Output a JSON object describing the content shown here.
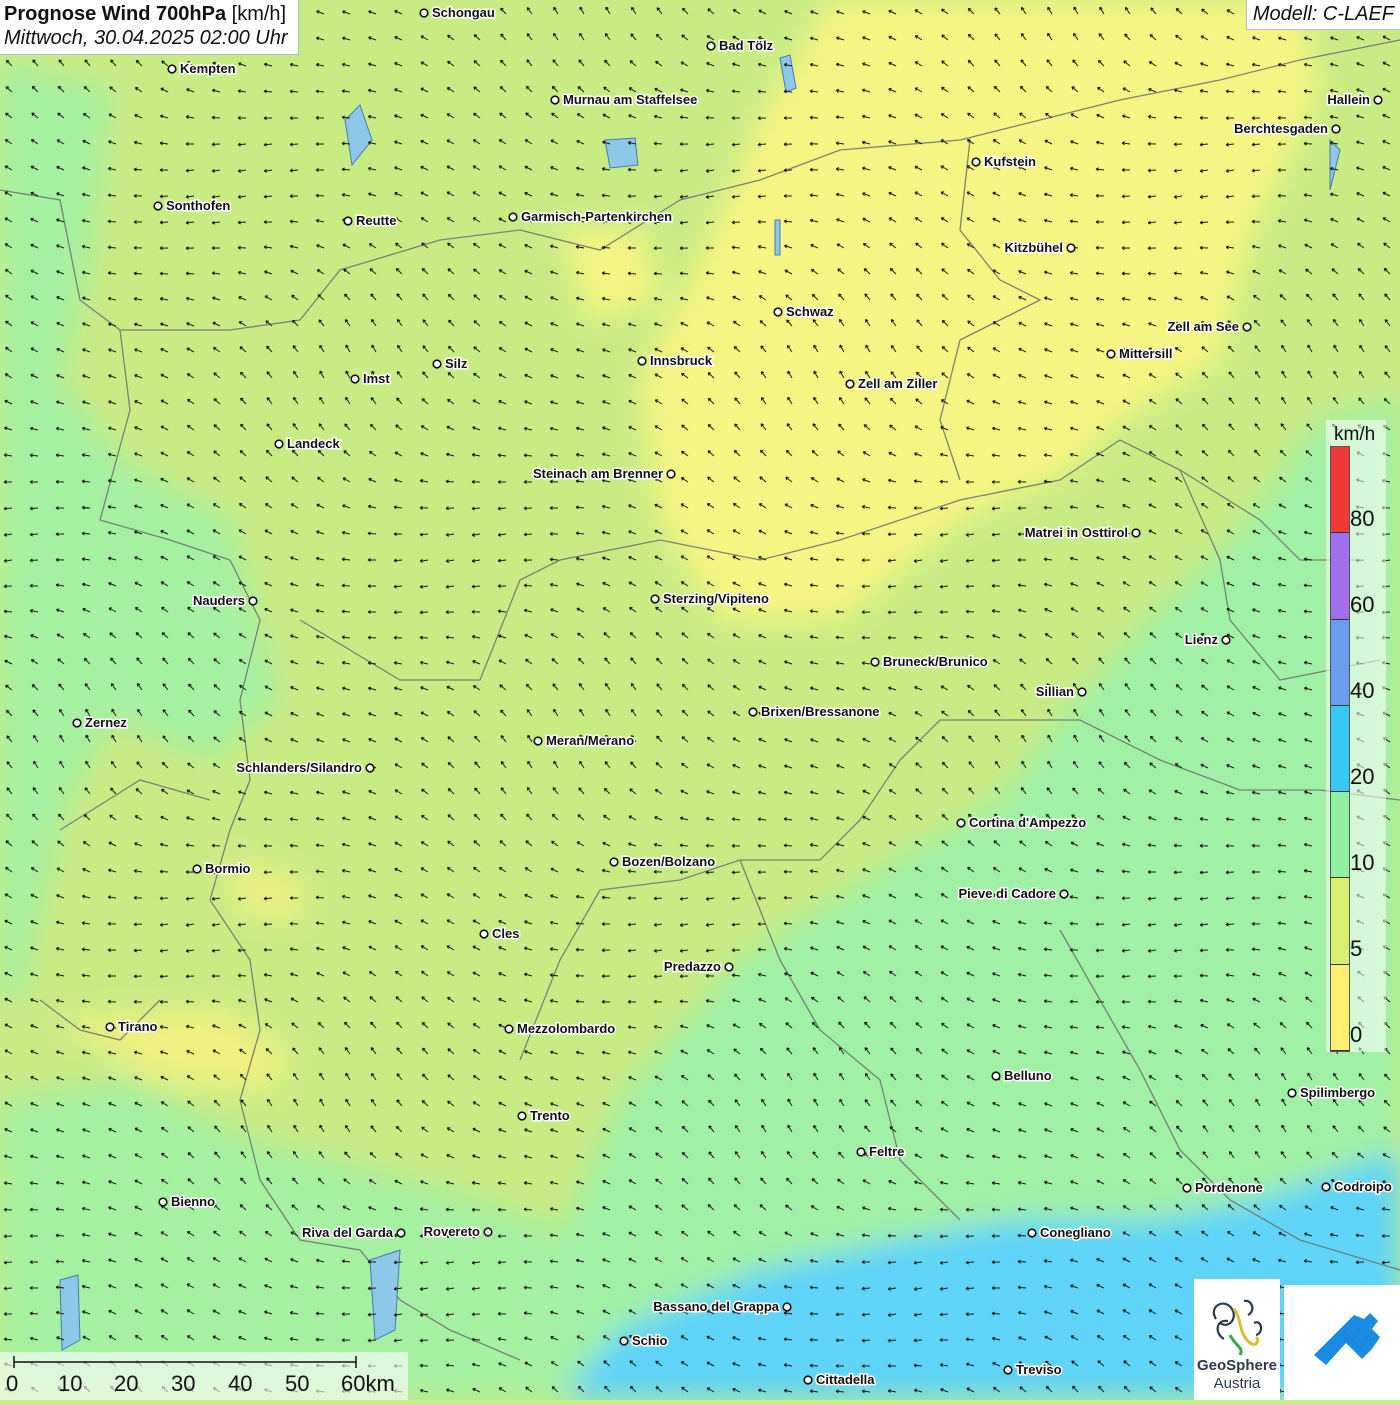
{
  "header": {
    "title_main": "Prognose Wind 700hPa",
    "title_unit": "[km/h]",
    "subtitle": "Mittwoch, 30.04.2025 02:00 Uhr",
    "model": "Modell: C-LAEF"
  },
  "legend": {
    "unit": "km/h",
    "ticks": [
      "80",
      "60",
      "40",
      "20",
      "10",
      "5",
      "0"
    ],
    "colors": [
      "#f03a3a",
      "#a070f0",
      "#6a9cf0",
      "#38c8f8",
      "#90f0a0",
      "#d8f070",
      "#fff070"
    ]
  },
  "scale_bar": {
    "labels": [
      "0",
      "10",
      "20",
      "30",
      "40",
      "50",
      "60km"
    ]
  },
  "logo": {
    "line1": "GeoSphere",
    "line2": "Austria"
  },
  "cities": [
    {
      "name": "Schongau"
    },
    {
      "name": "Bad Tölz"
    },
    {
      "name": "Kempten"
    },
    {
      "name": "Murnau am Staffelsee"
    },
    {
      "name": "Hallein"
    },
    {
      "name": "Berchtesgaden"
    },
    {
      "name": "Kufstein"
    },
    {
      "name": "Sonthofen"
    },
    {
      "name": "Reutte"
    },
    {
      "name": "Garmisch-Partenkirchen"
    },
    {
      "name": "Kitzbühel"
    },
    {
      "name": "Schwaz"
    },
    {
      "name": "Zell am See"
    },
    {
      "name": "Mittersill"
    },
    {
      "name": "Silz"
    },
    {
      "name": "Innsbruck"
    },
    {
      "name": "Imst"
    },
    {
      "name": "Zell am Ziller"
    },
    {
      "name": "Landeck"
    },
    {
      "name": "Steinach am Brenner"
    },
    {
      "name": "Matrei in Osttirol"
    },
    {
      "name": "Nauders"
    },
    {
      "name": "Sterzing/Vipiteno"
    },
    {
      "name": "Lienz"
    },
    {
      "name": "Bruneck/Brunico"
    },
    {
      "name": "Sillian"
    },
    {
      "name": "Brixen/Bressanone"
    },
    {
      "name": "Zernez"
    },
    {
      "name": "Meran/Merano"
    },
    {
      "name": "Schlanders/Silandro"
    },
    {
      "name": "Cortina d'Ampezzo"
    },
    {
      "name": "Bozen/Bolzano"
    },
    {
      "name": "Bormio"
    },
    {
      "name": "Pieve di Cadore"
    },
    {
      "name": "Cles"
    },
    {
      "name": "Predazzo"
    },
    {
      "name": "Tirano"
    },
    {
      "name": "Mezzolombardo"
    },
    {
      "name": "Belluno"
    },
    {
      "name": "Spilimbergo"
    },
    {
      "name": "Trento"
    },
    {
      "name": "Feltre"
    },
    {
      "name": "Pordenone"
    },
    {
      "name": "Codroipo"
    },
    {
      "name": "Bienno"
    },
    {
      "name": "Riva del Garda"
    },
    {
      "name": "Rovereto"
    },
    {
      "name": "Conegliano"
    },
    {
      "name": "Bassano del Grappa"
    },
    {
      "name": "Schio"
    },
    {
      "name": "Treviso"
    },
    {
      "name": "Cittadella"
    }
  ]
}
